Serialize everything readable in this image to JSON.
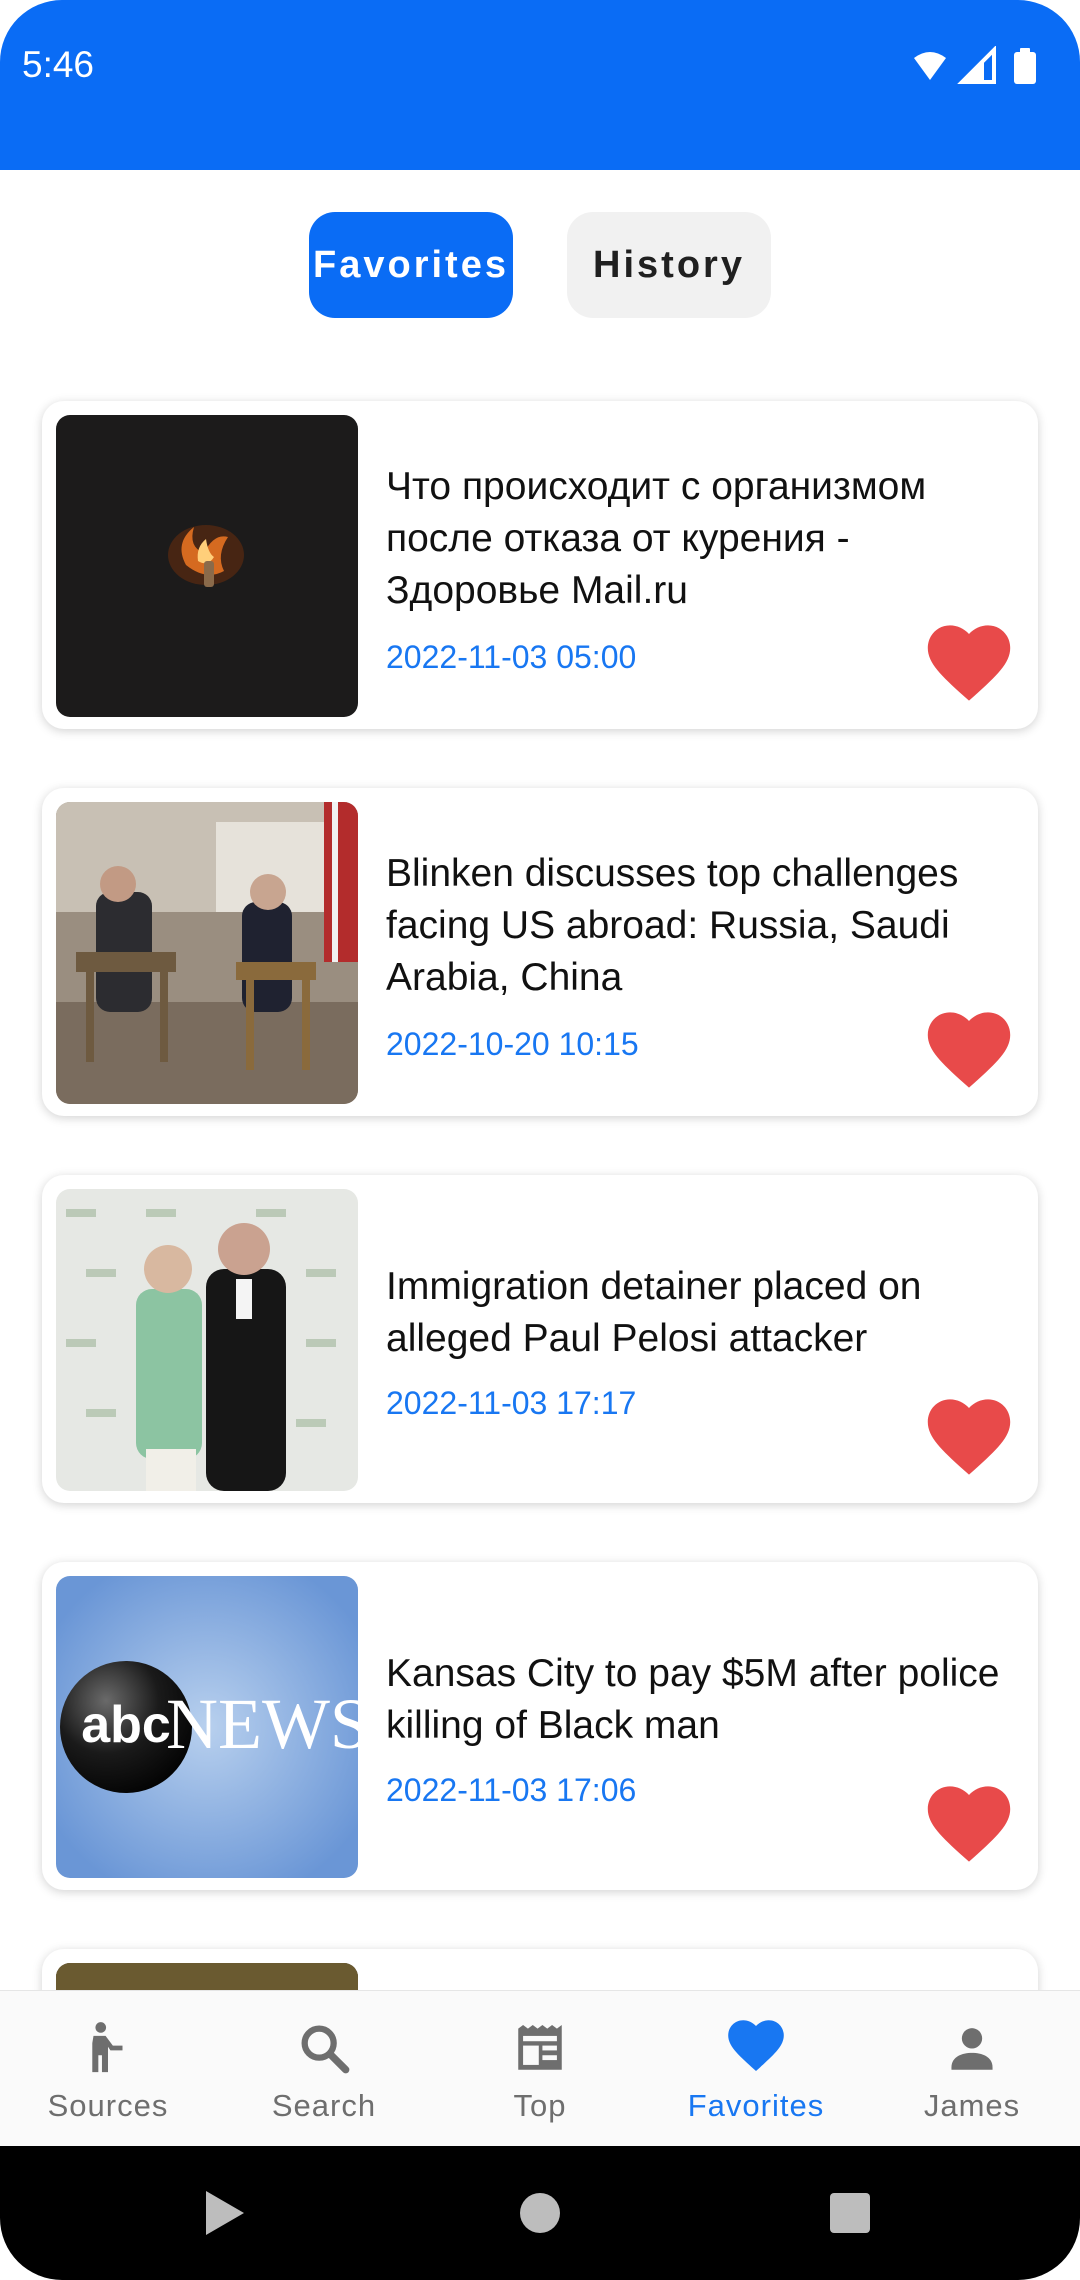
{
  "status_bar": {
    "time": "5:46",
    "accent_color": "#0a6cf5"
  },
  "tabs": {
    "favorites_label": "Favorites",
    "history_label": "History",
    "active": "Favorites"
  },
  "articles": [
    {
      "title": "Что происходит с организмом после отказа от курения - Здоровье Mail.ru",
      "date": "2022-11-03 05:00",
      "favorited": true,
      "thumbnail": "lighter-flame-dark"
    },
    {
      "title": "Blinken discusses top challenges facing US abroad: Russia, Saudi Arabia, China",
      "date": "2022-10-20 10:15",
      "favorited": true,
      "thumbnail": "interview-photo"
    },
    {
      "title": "Immigration detainer placed on alleged Paul Pelosi attacker",
      "date": "2022-11-03 17:17",
      "favorited": true,
      "thumbnail": "event-photo"
    },
    {
      "title": "Kansas City to pay $5M after police killing of Black man",
      "date": "2022-11-03 17:06",
      "favorited": true,
      "thumbnail": "abc-news-logo",
      "thumbnail_text": [
        "abc",
        "NEWS"
      ]
    }
  ],
  "bottom_nav": {
    "items": [
      {
        "label": "Sources",
        "icon": "person-walk-icon"
      },
      {
        "label": "Search",
        "icon": "search-icon"
      },
      {
        "label": "Top",
        "icon": "newspaper-icon"
      },
      {
        "label": "Favorites",
        "icon": "heart-icon"
      },
      {
        "label": "James",
        "icon": "person-icon"
      }
    ],
    "active": "Favorites"
  },
  "colors": {
    "heart": "#e84a4a",
    "date": "#1877f2",
    "active_nav": "#1877f2"
  }
}
